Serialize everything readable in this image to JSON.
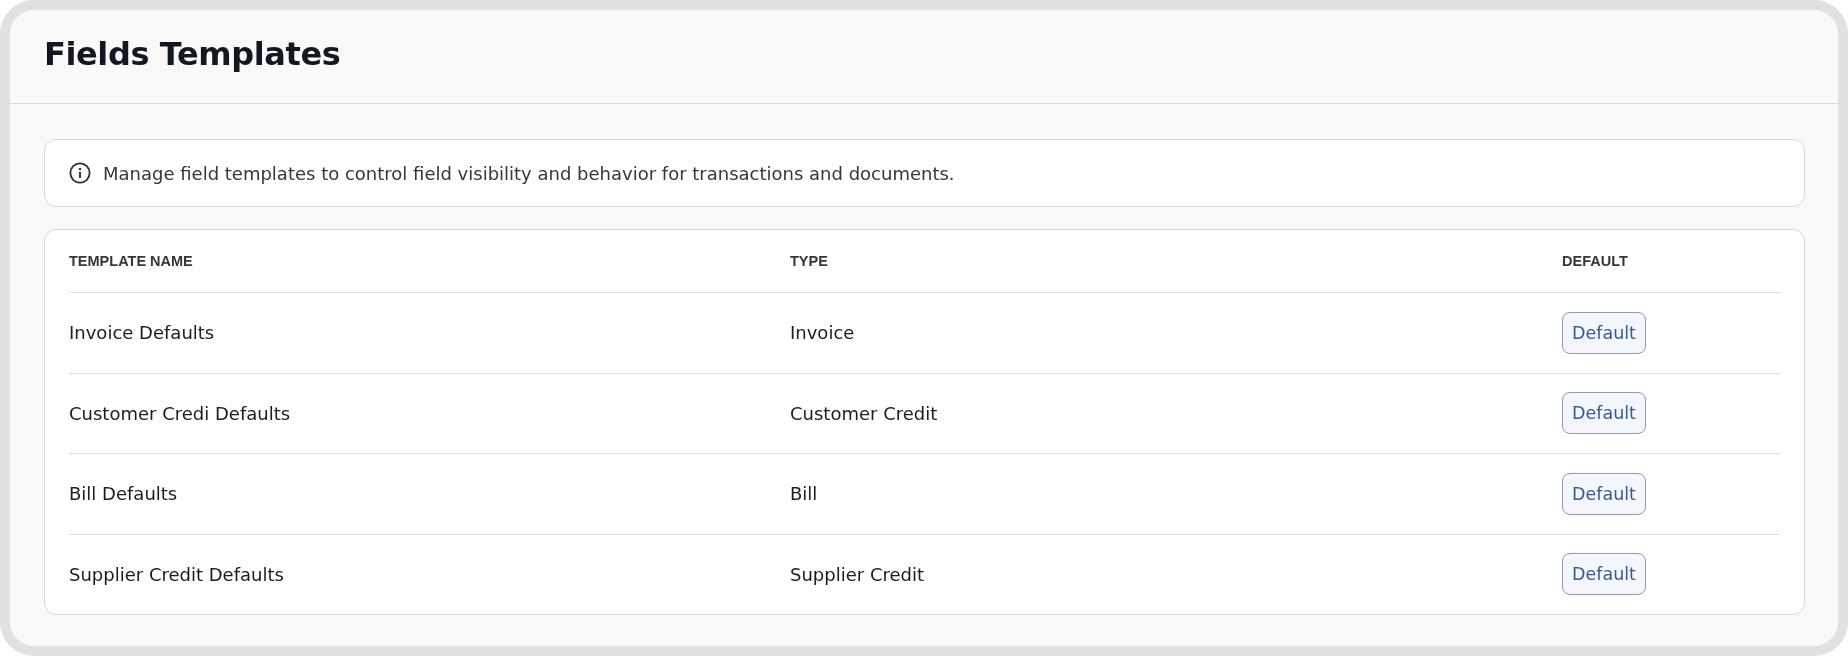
{
  "page": {
    "title": "Fields Templates"
  },
  "info_banner": {
    "text": "Manage field templates to control field visibility and behavior for transactions and documents."
  },
  "table": {
    "columns": [
      "TEMPLATE NAME",
      "TYPE",
      "DEFAULT"
    ],
    "rows": [
      {
        "template_name": "Invoice Defaults",
        "type": "Invoice",
        "default": "Default"
      },
      {
        "template_name": "Customer Credi Defaults",
        "type": "Customer Credit",
        "default": "Default"
      },
      {
        "template_name": "Bill Defaults",
        "type": "Bill",
        "default": "Default"
      },
      {
        "template_name": "Supplier Credit Defaults",
        "type": "Supplier Credit",
        "default": "Default"
      }
    ]
  }
}
